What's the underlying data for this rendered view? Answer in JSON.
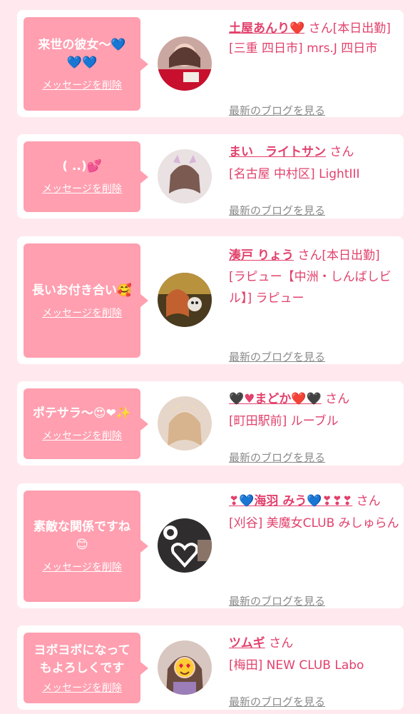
{
  "common": {
    "delete_label": "メッセージを削除",
    "blog_label": "最新のブログを見る",
    "san": " さん"
  },
  "messages": [
    {
      "message": "来世の彼女〜💙\n💙💙",
      "name": "土屋あんり❤️",
      "shop": "[本日出勤]\n[三重 四日市] mrs.J 四日市",
      "status": ""
    },
    {
      "message": "( ..)💕",
      "name": "まい　ライトサン",
      "shop": "[名古屋 中村区] LightIII",
      "status": ""
    },
    {
      "message": "長いお付き合い🥰",
      "name": "湊戸 りょう",
      "shop": "[本日出勤]\n[ラピュー【中洲・しんばしビル】] ラピュー",
      "status": ""
    },
    {
      "message": "ポテサラ〜😍❤✨",
      "name": "🖤♥まどか❤️🖤",
      "shop": "[町田駅前] ルーブル",
      "status": ""
    },
    {
      "message": "素敵な関係ですね\n😊",
      "name": "❣💙海羽 みう💙❣❣❣",
      "shop": "[刈谷] 美魔女CLUB みしゅらん",
      "status": ""
    },
    {
      "message": "ヨボヨボになって\nもよろしくです",
      "name": "ツムギ",
      "shop": "[梅田] NEW CLUB Labo",
      "status": ""
    }
  ],
  "colors": {
    "background": "#ffe9ee",
    "bubble": "#ff9fb0",
    "accent": "#e2416c",
    "link_gray": "#8a8a8a"
  },
  "icons": [
    "avatar-photo",
    "avatar-photo",
    "avatar-photo",
    "avatar-photo",
    "avatar-photo",
    "avatar-photo"
  ]
}
